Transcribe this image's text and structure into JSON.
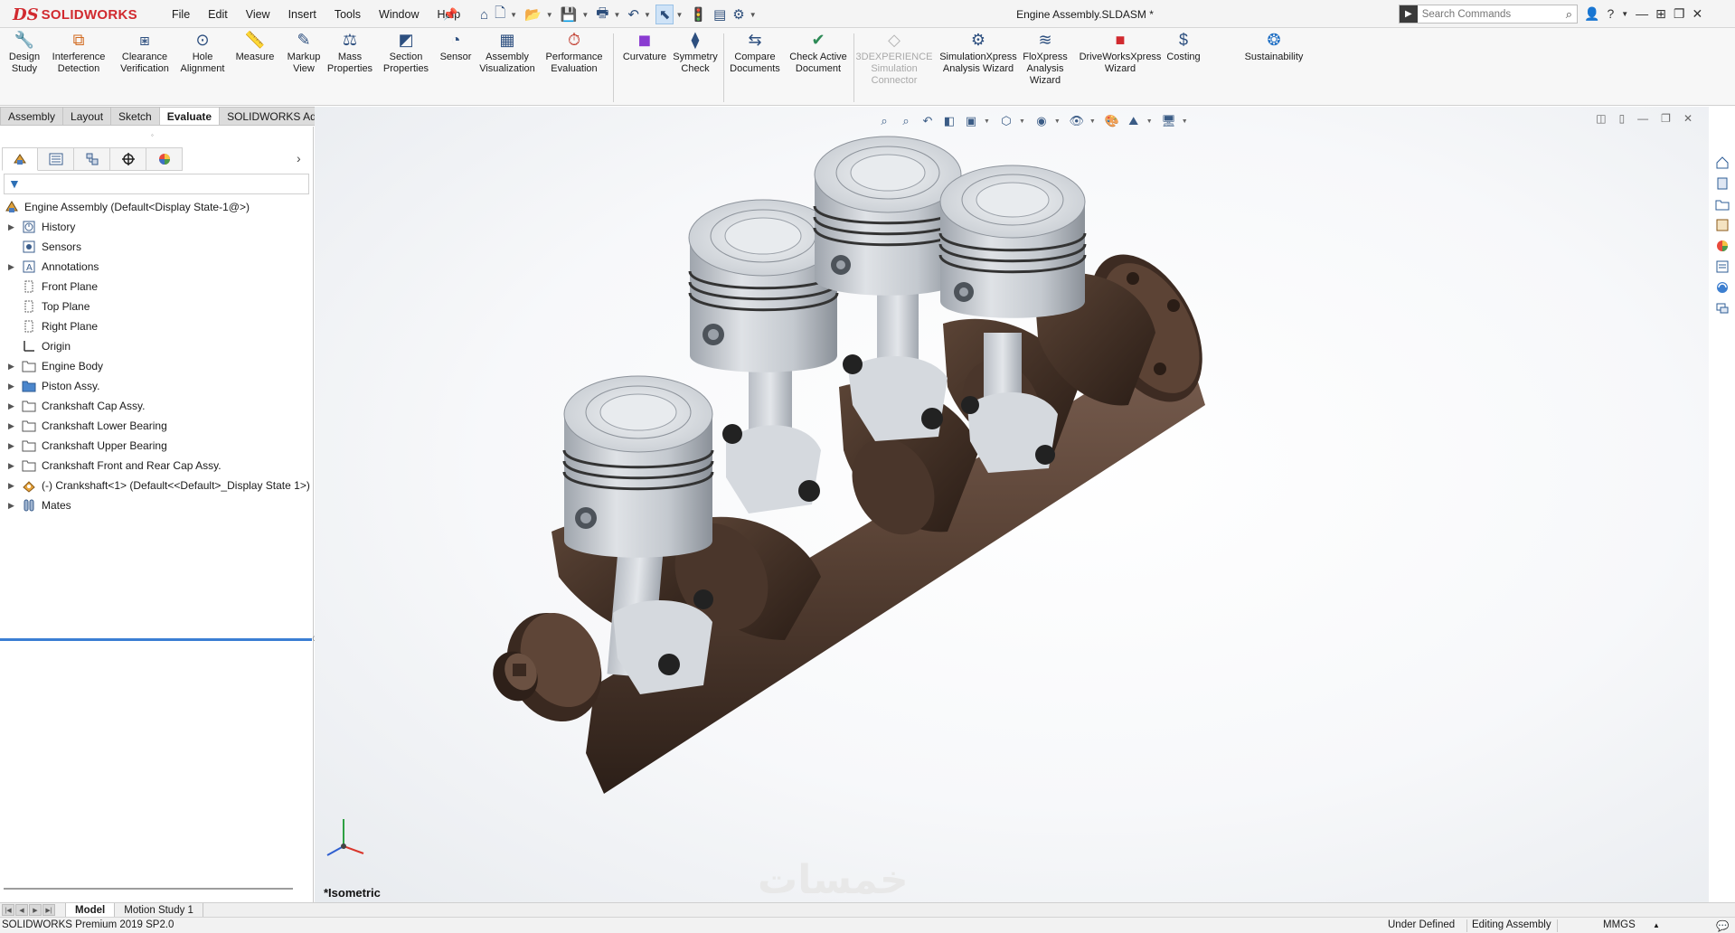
{
  "app": {
    "brand_mark": "DS",
    "brand": "SOLIDWORKS",
    "document_title": "Engine Assembly.SLDASM *"
  },
  "menu": [
    "File",
    "Edit",
    "View",
    "Insert",
    "Tools",
    "Window",
    "Help"
  ],
  "search": {
    "placeholder": "Search Commands"
  },
  "command_manager": {
    "commands": [
      {
        "label": "Design\nStudy",
        "icon": "design-study-icon",
        "enabled": true
      },
      {
        "label": "Interference\nDetection",
        "icon": "interference-icon",
        "enabled": true
      },
      {
        "label": "Clearance\nVerification",
        "icon": "clearance-icon",
        "enabled": true
      },
      {
        "label": "Hole\nAlignment",
        "icon": "hole-alignment-icon",
        "enabled": true
      },
      {
        "label": "Measure",
        "icon": "measure-icon",
        "enabled": true
      },
      {
        "label": "Markup\nView",
        "icon": "markup-icon",
        "enabled": true
      },
      {
        "label": "Mass\nProperties",
        "icon": "mass-properties-icon",
        "enabled": true
      },
      {
        "label": "Section\nProperties",
        "icon": "section-properties-icon",
        "enabled": true
      },
      {
        "label": "Sensor",
        "icon": "sensor-icon",
        "enabled": true
      },
      {
        "label": "Assembly\nVisualization",
        "icon": "assembly-visualization-icon",
        "enabled": true
      },
      {
        "label": "Performance\nEvaluation",
        "icon": "performance-icon",
        "enabled": true
      },
      {
        "label": "Curvature",
        "icon": "curvature-icon",
        "enabled": true
      },
      {
        "label": "Symmetry\nCheck",
        "icon": "symmetry-icon",
        "enabled": true
      },
      {
        "label": "Compare\nDocuments",
        "icon": "compare-icon",
        "enabled": true
      },
      {
        "label": "Check Active\nDocument",
        "icon": "check-document-icon",
        "enabled": true
      },
      {
        "label": "3DEXPERIENCE\nSimulation\nConnector",
        "icon": "3dexperience-icon",
        "enabled": false
      },
      {
        "label": "SimulationXpress\nAnalysis Wizard",
        "icon": "simulationxpress-icon",
        "enabled": true
      },
      {
        "label": "FloXpress\nAnalysis\nWizard",
        "icon": "floxpress-icon",
        "enabled": true
      },
      {
        "label": "DriveWorksXpress\nWizard",
        "icon": "driveworks-icon",
        "enabled": true
      },
      {
        "label": "Costing",
        "icon": "costing-icon",
        "enabled": true
      },
      {
        "label": "Sustainability",
        "icon": "sustainability-icon",
        "enabled": true
      }
    ]
  },
  "tabs": [
    {
      "label": "Assembly",
      "active": false
    },
    {
      "label": "Layout",
      "active": false
    },
    {
      "label": "Sketch",
      "active": false
    },
    {
      "label": "Evaluate",
      "active": true
    },
    {
      "label": "SOLIDWORKS Add-Ins",
      "active": false
    }
  ],
  "feature_tree": [
    {
      "label": "Engine Assembly  (Default<Display State-1@>)",
      "icon": "assembly-icon",
      "expandable": false,
      "root": true
    },
    {
      "label": "History",
      "icon": "history-icon",
      "expandable": true
    },
    {
      "label": "Sensors",
      "icon": "sensors-icon",
      "expandable": false
    },
    {
      "label": "Annotations",
      "icon": "annotations-icon",
      "expandable": true
    },
    {
      "label": "Front Plane",
      "icon": "plane-icon",
      "expandable": false
    },
    {
      "label": "Top Plane",
      "icon": "plane-icon",
      "expandable": false
    },
    {
      "label": "Right Plane",
      "icon": "plane-icon",
      "expandable": false
    },
    {
      "label": "Origin",
      "icon": "origin-icon",
      "expandable": false
    },
    {
      "label": "Engine Body",
      "icon": "folder-icon",
      "expandable": true
    },
    {
      "label": "Piston Assy.",
      "icon": "folder-filled-icon",
      "expandable": true
    },
    {
      "label": "Crankshaft Cap Assy.",
      "icon": "folder-icon",
      "expandable": true
    },
    {
      "label": "Crankshaft Lower Bearing",
      "icon": "folder-icon",
      "expandable": true
    },
    {
      "label": "Crankshaft Upper Bearing",
      "icon": "folder-icon",
      "expandable": true
    },
    {
      "label": "Crankshaft Front and Rear Cap Assy.",
      "icon": "folder-icon",
      "expandable": true
    },
    {
      "label": "(-) Crankshaft<1> (Default<<Default>_Display State 1>)",
      "icon": "part-icon",
      "expandable": true
    },
    {
      "label": "Mates",
      "icon": "mates-icon",
      "expandable": true
    }
  ],
  "viewport": {
    "view_name": "*Isometric",
    "watermark": "خمسات"
  },
  "bottom_tabs": [
    {
      "label": "Model",
      "active": true
    },
    {
      "label": "Motion Study 1",
      "active": false
    }
  ],
  "status": {
    "product": "SOLIDWORKS Premium 2019 SP2.0",
    "definition": "Under Defined",
    "mode": "Editing Assembly",
    "units": "MMGS"
  },
  "colors": {
    "brand_red": "#d12a2f",
    "piston_silver": "#c8ccd3",
    "crank_brown": "#5a4336",
    "selection_blue": "#3b7ed3"
  }
}
